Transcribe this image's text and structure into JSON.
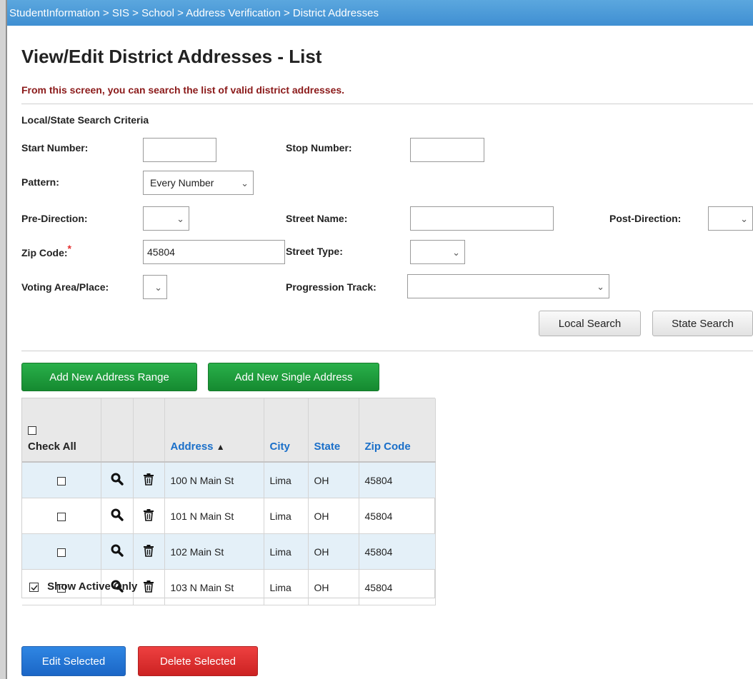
{
  "breadcrumb": "StudentInformation > SIS > School > Address Verification > District Addresses",
  "page_title": "View/Edit District Addresses - List",
  "instruction": "From this screen, you can search the list of valid district addresses.",
  "search": {
    "section_title": "Local/State Search Criteria",
    "start_number_label": "Start Number:",
    "start_number_value": "",
    "stop_number_label": "Stop Number:",
    "stop_number_value": "",
    "pattern_label": "Pattern:",
    "pattern_value": "Every Number",
    "pre_direction_label": "Pre-Direction:",
    "pre_direction_value": "",
    "street_name_label": "Street Name:",
    "street_name_value": "",
    "post_direction_label": "Post-Direction:",
    "post_direction_value": "",
    "zip_code_label": "Zip Code:",
    "zip_code_required_mark": "*",
    "zip_code_value": "45804",
    "street_type_label": "Street Type:",
    "street_type_value": "",
    "voting_area_label": "Voting Area/Place:",
    "voting_area_value": "",
    "progression_track_label": "Progression Track:",
    "progression_track_value": "",
    "local_search_label": "Local Search",
    "state_search_label": "State Search"
  },
  "actions": {
    "add_range_label": "Add New Address Range",
    "add_single_label": "Add New Single Address"
  },
  "table": {
    "check_all_label": "Check All",
    "headers": {
      "address": "Address",
      "city": "City",
      "state": "State",
      "zip": "Zip Code"
    },
    "sort_indicator": "▲",
    "rows": [
      {
        "address": "100 N Main St",
        "city": "Lima",
        "state": "OH",
        "zip": "45804",
        "checked": false
      },
      {
        "address": "101 N Main St",
        "city": "Lima",
        "state": "OH",
        "zip": "45804",
        "checked": false
      },
      {
        "address": "102 Main St",
        "city": "Lima",
        "state": "OH",
        "zip": "45804",
        "checked": false
      },
      {
        "address": "103 N Main St",
        "city": "Lima",
        "state": "OH",
        "zip": "45804",
        "checked": false
      }
    ],
    "show_active_label": "Show Active Only",
    "show_active_checked": true
  },
  "bottom": {
    "edit_selected_label": "Edit Selected",
    "delete_selected_label": "Delete Selected"
  },
  "colors": {
    "breadcrumb_bar": "#4a99d8",
    "instruction_text": "#8b1a1a",
    "header_link": "#1a6fc9",
    "row_shade": "#e4f0f8",
    "green_button": "#1e9e3e",
    "blue_button": "#2574d4",
    "red_button": "#dd3030"
  },
  "icons": {
    "view": "magnifier-icon",
    "delete": "trash-icon",
    "dropdown": "chevron-down-icon"
  }
}
